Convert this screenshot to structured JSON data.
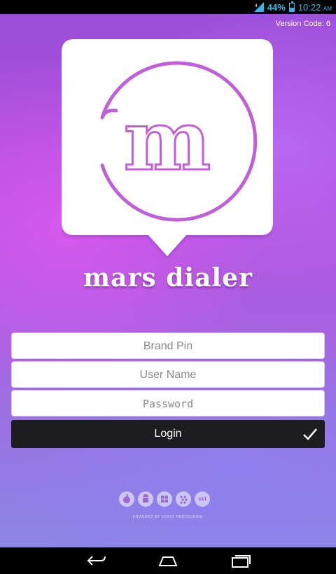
{
  "status_bar": {
    "battery_percent": "44%",
    "battery_level": 0.44,
    "time": "10:22",
    "ampm": "AM",
    "accent_color": "#33b5e5",
    "icons": [
      "signal-icon",
      "battery-icon"
    ]
  },
  "app": {
    "version_label": "Version Code: 6",
    "logo_letter": "m",
    "brand_name": "mars dialer"
  },
  "form": {
    "brand_pin_placeholder": "Brand Pin",
    "username_placeholder": "User Name",
    "password_placeholder": "Password",
    "login_label": "Login"
  },
  "footer": {
    "platforms": [
      "apple-icon",
      "android-icon",
      "windows-icon",
      "blackberry-icon",
      "ovi"
    ],
    "ovi_label": "ovi",
    "powered_by": "POWERED BY XXXXX PROCESSING"
  },
  "nav": {
    "icons": [
      "back-icon",
      "home-icon",
      "recent-apps-icon"
    ]
  }
}
